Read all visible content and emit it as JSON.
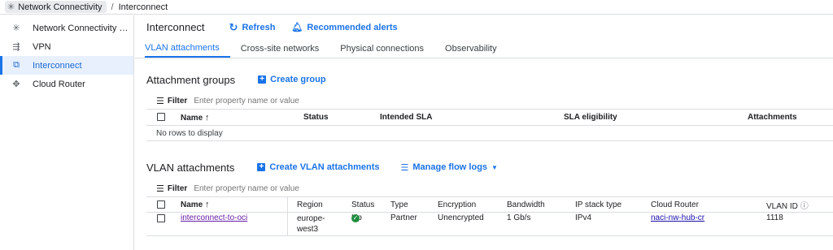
{
  "breadcrumb": {
    "product": "Network Connectivity",
    "separator": "/",
    "page": "Interconnect"
  },
  "sidebar": {
    "items": [
      {
        "label": "Network Connectivity Cen...",
        "icon": "hub-icon",
        "active": false
      },
      {
        "label": "VPN",
        "icon": "vpn-icon",
        "active": false
      },
      {
        "label": "Interconnect",
        "icon": "interconnect-icon",
        "active": true
      },
      {
        "label": "Cloud Router",
        "icon": "router-icon",
        "active": false
      }
    ]
  },
  "header": {
    "title": "Interconnect",
    "refresh": "Refresh",
    "alerts": "Recommended alerts"
  },
  "tabs": [
    "VLAN attachments",
    "Cross-site networks",
    "Physical connections",
    "Observability"
  ],
  "attachment_groups": {
    "title": "Attachment groups",
    "create": "Create group",
    "filter_label": "Filter",
    "filter_placeholder": "Enter property name or value",
    "columns": [
      "Name",
      "Status",
      "Intended SLA",
      "SLA eligibility",
      "Attachments"
    ],
    "empty": "No rows to display"
  },
  "vlan": {
    "title": "VLAN attachments",
    "create": "Create VLAN attachments",
    "manage": "Manage flow logs",
    "filter_label": "Filter",
    "filter_placeholder": "Enter property name or value",
    "columns": [
      "Name",
      "Region",
      "Status",
      "Type",
      "Encryption",
      "Bandwidth",
      "IP stack type",
      "Cloud Router",
      "VLAN ID"
    ],
    "rows": [
      {
        "name": "interconnect-to-oci",
        "region_line1": "europe-",
        "region_line2": "west3",
        "status": "Up",
        "type": "Partner",
        "encryption": "Unencrypted",
        "bandwidth": "1 Gb/s",
        "ip_stack": "IPv4",
        "router": "naci-nw-hub-cr",
        "vlan_id": "1118"
      }
    ]
  },
  "colors": {
    "accent": "#1a73e8",
    "active_bg": "#e8f0fe",
    "ok": "#1e8e3e"
  }
}
